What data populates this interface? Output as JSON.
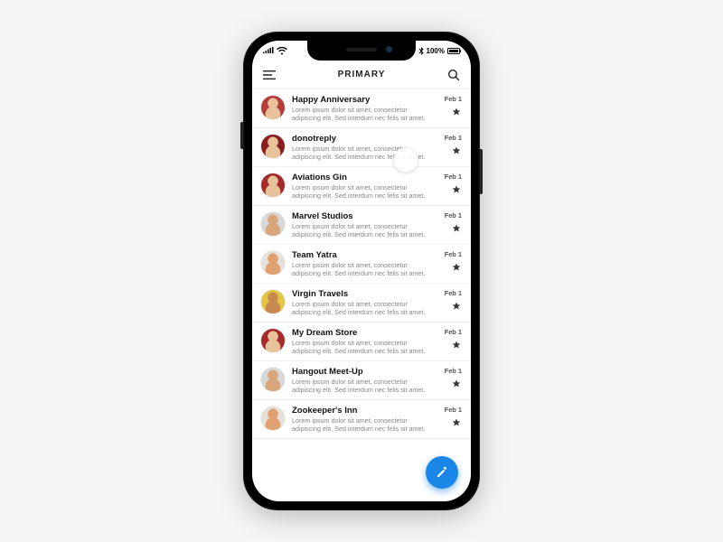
{
  "statusbar": {
    "bt": "᚛",
    "battery": "100%"
  },
  "navbar": {
    "title": "PRIMARY"
  },
  "preview_text": "Lorem ipsum dolor sit amet, consectetur adipiscing elit. Sed interdum nec felis sit amet.",
  "date_label": "Feb 1",
  "emails": [
    {
      "sender": "Happy Anniversary",
      "avatar_bg": "#b53a3a",
      "avatar_face": "#e7c29b"
    },
    {
      "sender": "donotreply",
      "avatar_bg": "#8a1d1d",
      "avatar_face": "#e7c29b"
    },
    {
      "sender": "Aviations Gin",
      "avatar_bg": "#a72a2a",
      "avatar_face": "#e7c29b"
    },
    {
      "sender": "Marvel Studios",
      "avatar_bg": "#d8d8d8",
      "avatar_face": "#d9a57a"
    },
    {
      "sender": "Team Yatra",
      "avatar_bg": "#e7e1db",
      "avatar_face": "#e0a070"
    },
    {
      "sender": "Virgin Travels",
      "avatar_bg": "#e4c642",
      "avatar_face": "#c98852"
    },
    {
      "sender": "My Dream Store",
      "avatar_bg": "#a72a2a",
      "avatar_face": "#e7c29b"
    },
    {
      "sender": "Hangout Meet-Up",
      "avatar_bg": "#d8d8d8",
      "avatar_face": "#d9a57a"
    },
    {
      "sender": "Zookeeper's Inn",
      "avatar_bg": "#e7e1db",
      "avatar_face": "#e0a070"
    }
  ],
  "colors": {
    "fab": "#1a86e8"
  }
}
